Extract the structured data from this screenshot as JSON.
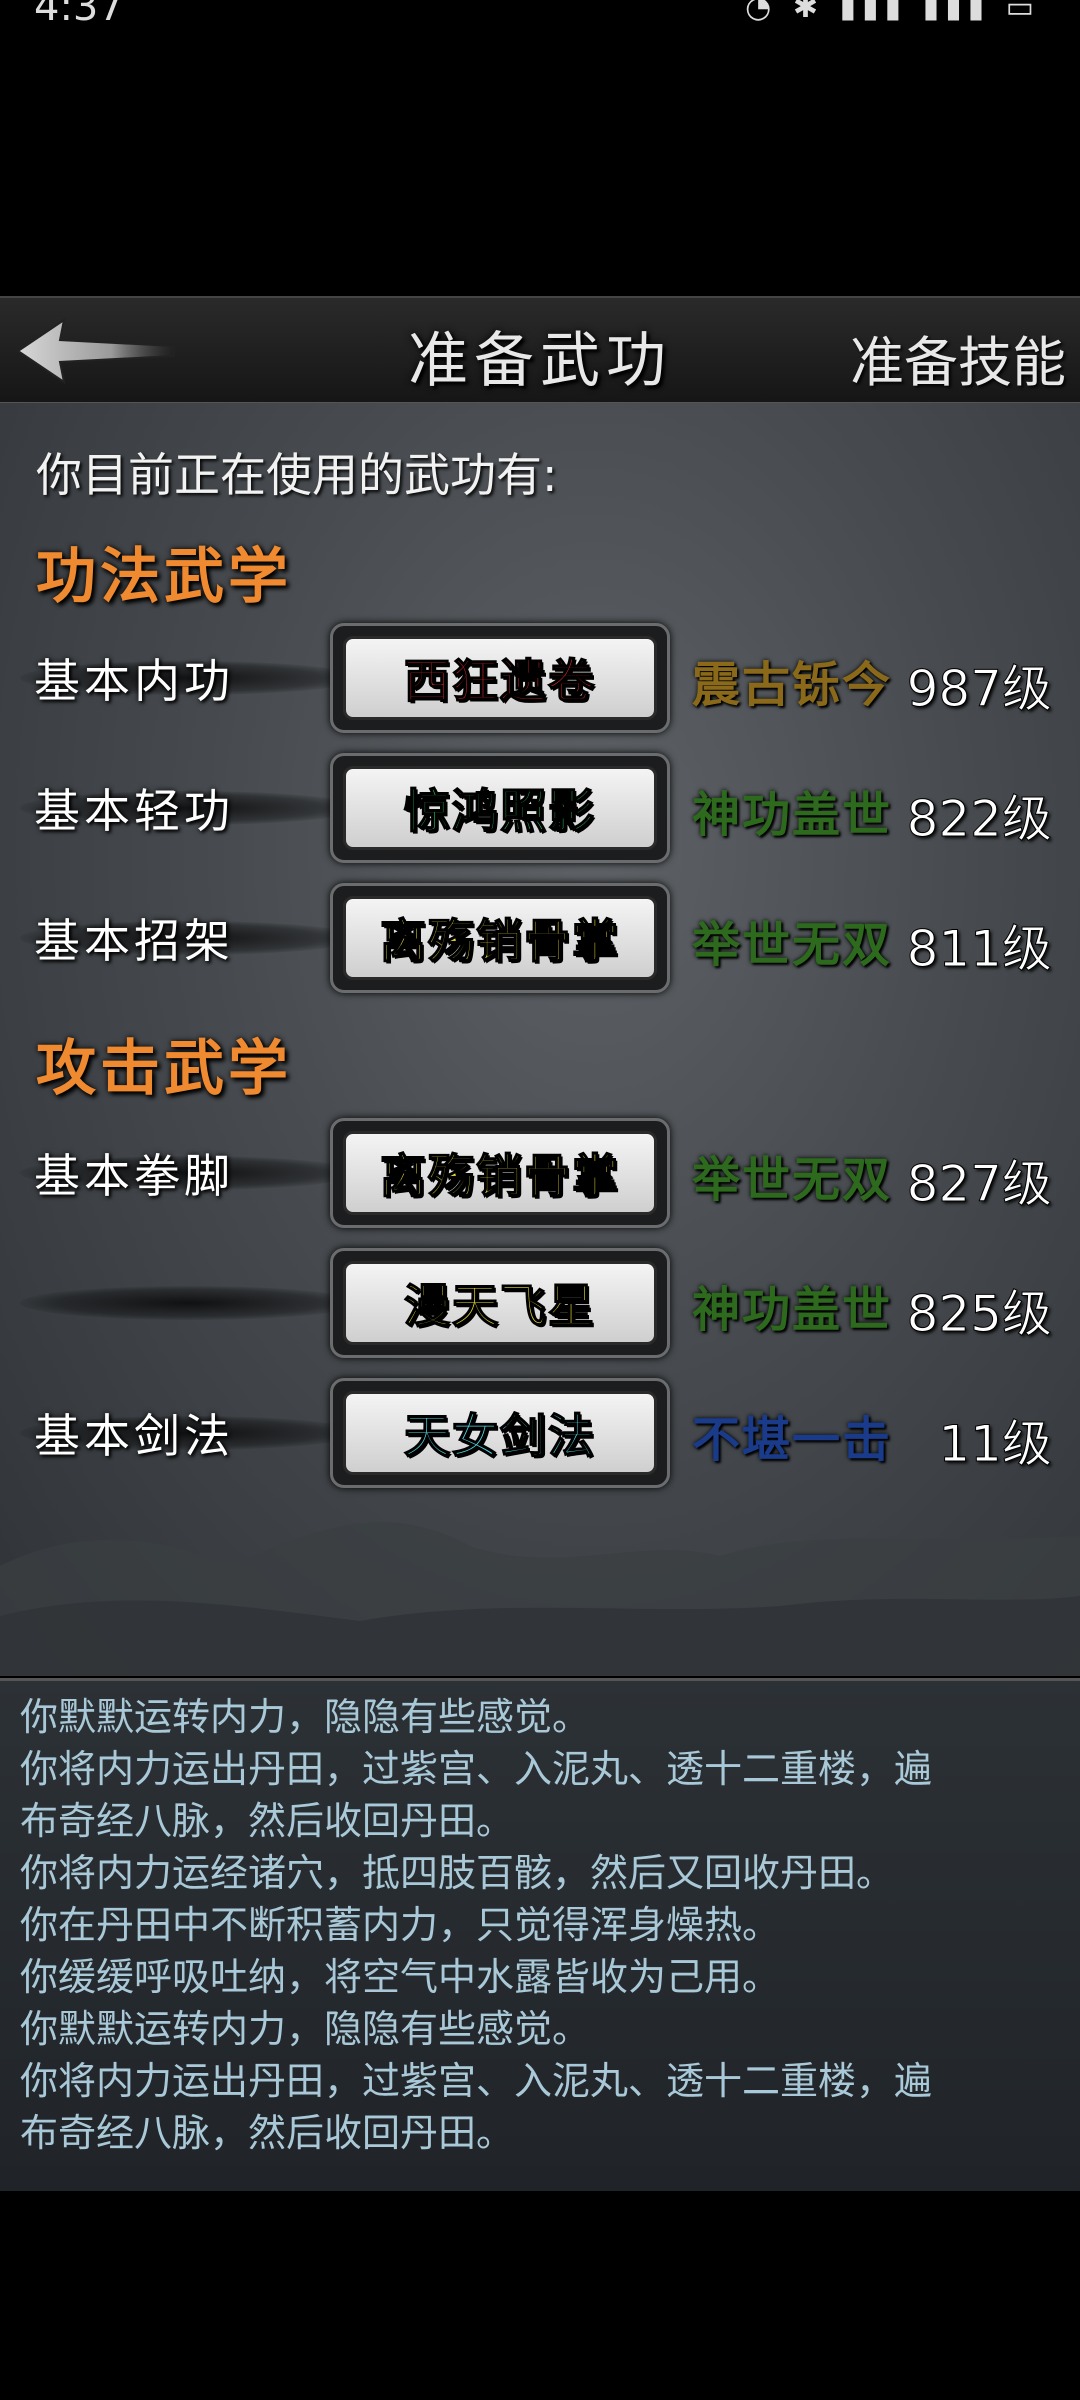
{
  "status_bar": {
    "time": "4:37",
    "indicators": "◔ ✱ ▮▮▮ ▮▮▮ ▭"
  },
  "header": {
    "title": "准备武功",
    "skill_button": "准备技能",
    "back_icon": "back-arrow-icon"
  },
  "intro": "你目前正在使用的武功有:",
  "sections": [
    {
      "title": "功法武学",
      "rows": [
        {
          "type": "基本内功",
          "skill": "西狂遗卷",
          "skill_color": "#e02828",
          "rank": "震古铄今",
          "rank_color": "#8a6a1a",
          "level": "987级"
        },
        {
          "type": "基本轻功",
          "skill": "惊鸿照影",
          "skill_color": "#2fc55a",
          "rank": "神功盖世",
          "rank_color": "#2d6a1e",
          "level": "822级"
        },
        {
          "type": "基本招架",
          "skill": "离殇销骨掌",
          "skill_color": "#f0e030",
          "rank": "举世无双",
          "rank_color": "#2d6a1e",
          "level": "811级"
        }
      ]
    },
    {
      "title": "攻击武学",
      "rows": [
        {
          "type": "基本拳脚",
          "skill": "离殇销骨掌",
          "skill_color": "#f0e030",
          "rank": "举世无双",
          "rank_color": "#2d6a1e",
          "level": "827级"
        },
        {
          "type": "",
          "skill": "漫天飞星",
          "skill_color": "#f0e030",
          "rank": "神功盖世",
          "rank_color": "#2d6a1e",
          "level": "825级"
        },
        {
          "type": "基本剑法",
          "skill": "天女剑法",
          "skill_color": "#4fd8e0",
          "rank": "不堪一击",
          "rank_color": "#1a3a8a",
          "level": "11级"
        }
      ]
    }
  ],
  "log": [
    "你默默运转内力，隐隐有些感觉。",
    "你将内力运出丹田，过紫宫、入泥丸、透十二重楼，遍",
    "布奇经八脉，然后收回丹田。",
    "你将内力运经诸穴，抵四肢百骸，然后又回收丹田。",
    "你在丹田中不断积蓄内力，只觉得浑身燥热。",
    "你缓缓呼吸吐纳，将空气中水露皆收为己用。",
    "你默默运转内力，隐隐有些感觉。",
    "你将内力运出丹田，过紫宫、入泥丸、透十二重楼，遍",
    "布奇经八脉，然后收回丹田。"
  ]
}
